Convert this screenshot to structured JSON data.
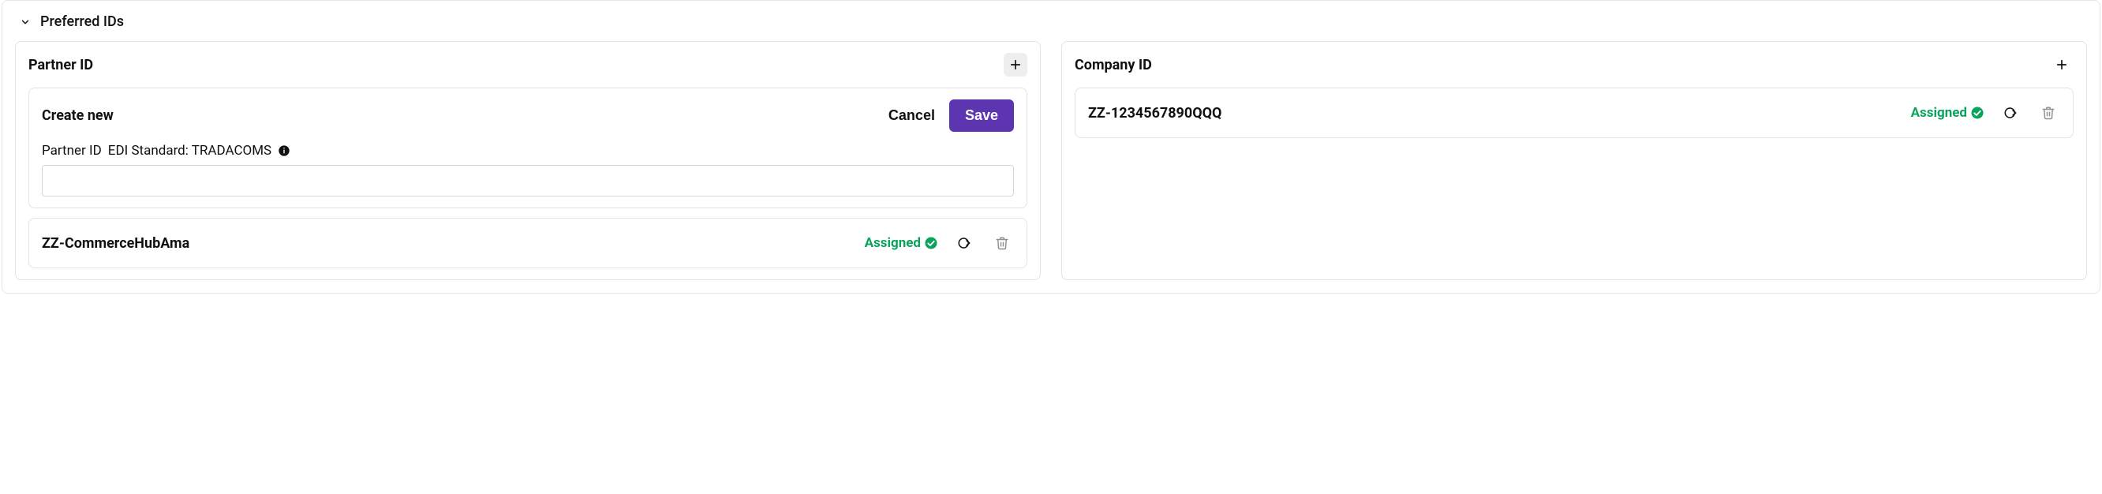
{
  "section": {
    "title": "Preferred IDs"
  },
  "partner": {
    "heading": "Partner ID",
    "createForm": {
      "title": "Create new",
      "cancelLabel": "Cancel",
      "saveLabel": "Save",
      "fieldLabel": "Partner ID",
      "standardLabel": "EDI Standard: TRADACOMS",
      "inputValue": ""
    },
    "items": [
      {
        "id": "ZZ-CommerceHubAma",
        "status": "Assigned"
      }
    ]
  },
  "company": {
    "heading": "Company ID",
    "items": [
      {
        "id": "ZZ-1234567890QQQ",
        "status": "Assigned"
      }
    ]
  }
}
